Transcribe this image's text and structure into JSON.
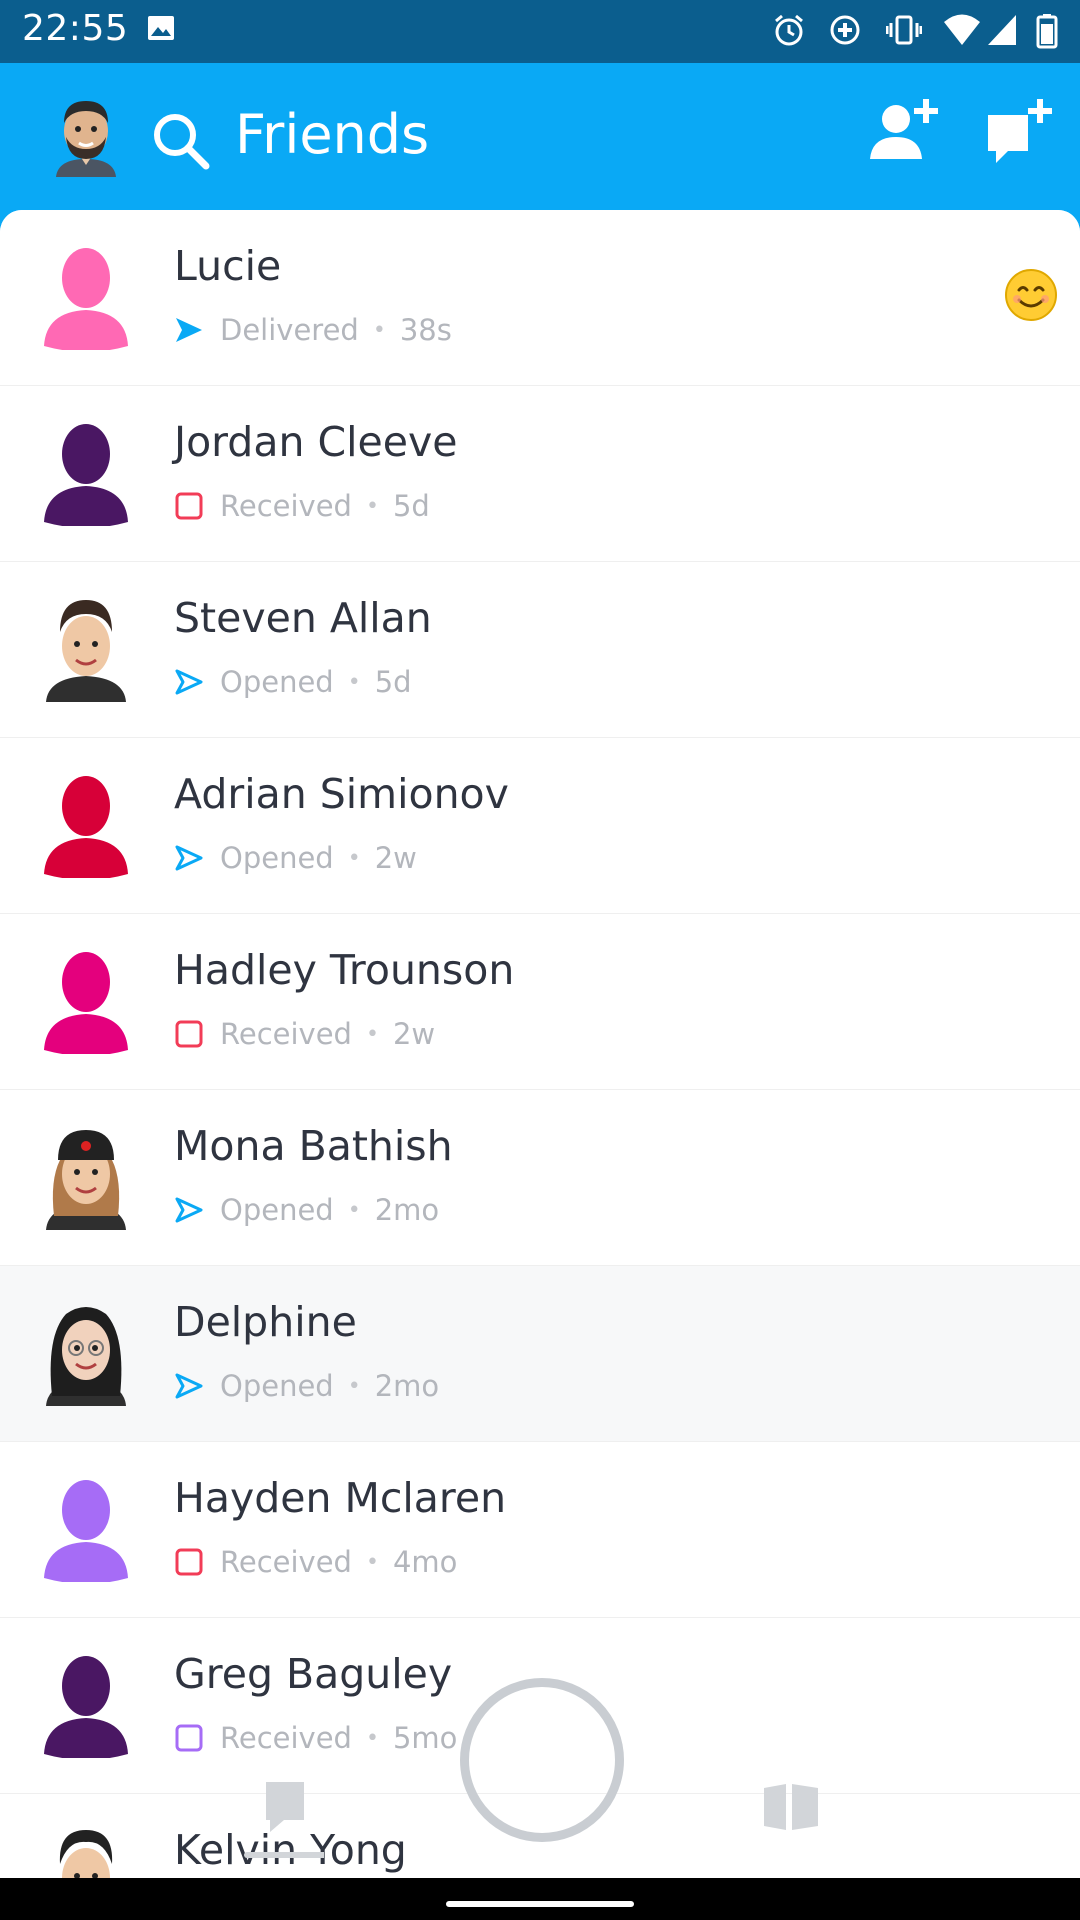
{
  "status_bar": {
    "time": "22:55"
  },
  "header": {
    "title": "Friends"
  },
  "friends": [
    {
      "name": "Lucie",
      "status": "Delivered",
      "time": "38s",
      "status_type": "delivered",
      "avatar_color": "#ff69b4",
      "emoji": "smiling-face-icon"
    },
    {
      "name": "Jordan Cleeve",
      "status": "Received",
      "time": "5d",
      "status_type": "received",
      "avatar_color": "#4a1763"
    },
    {
      "name": "Steven Allan",
      "status": "Opened",
      "time": "5d",
      "status_type": "opened",
      "avatar_type": "bitmoji-man"
    },
    {
      "name": "Adrian Simionov",
      "status": "Opened",
      "time": "2w",
      "status_type": "opened",
      "avatar_color": "#d70038"
    },
    {
      "name": "Hadley Trounson",
      "status": "Received",
      "time": "2w",
      "status_type": "received",
      "avatar_color": "#e4007d"
    },
    {
      "name": "Mona Bathish",
      "status": "Opened",
      "time": "2mo",
      "status_type": "opened",
      "avatar_type": "bitmoji-woman-cap"
    },
    {
      "name": "Delphine",
      "status": "Opened",
      "time": "2mo",
      "status_type": "opened",
      "avatar_type": "bitmoji-woman-glasses"
    },
    {
      "name": "Hayden Mclaren",
      "status": "Received",
      "time": "4mo",
      "status_type": "received",
      "avatar_color": "#a66cf6"
    },
    {
      "name": "Greg Baguley",
      "status": "Received",
      "time": "5mo",
      "status_type": "received-purple",
      "avatar_color": "#4a1763"
    },
    {
      "name": "Kelvin Yong",
      "status": "",
      "time": "",
      "status_type": "",
      "avatar_type": "bitmoji-man-2"
    }
  ],
  "colors": {
    "brand_blue": "#0aa9f5",
    "status_bar": "#0b5e8e",
    "received_red": "#f23c57",
    "received_purple": "#a66cf6",
    "opened_blue": "#0aa9f5"
  }
}
